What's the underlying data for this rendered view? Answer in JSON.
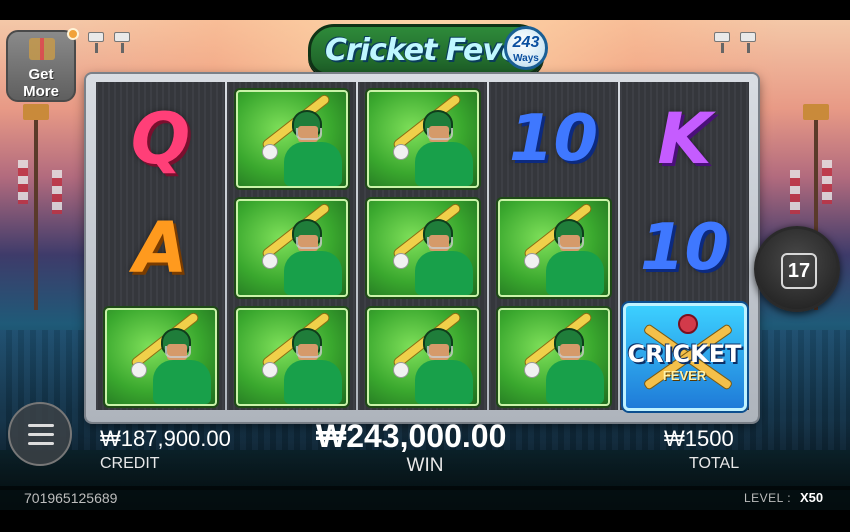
{
  "game": {
    "title_main": "Cricket Fever",
    "ways_number": "243",
    "ways_label": "Ways"
  },
  "get_more": {
    "line1": "Get",
    "line2": "More",
    "icon": "gift-icon"
  },
  "reels": [
    [
      "Q",
      "A",
      "batsman"
    ],
    [
      "batsman",
      "batsman",
      "batsman"
    ],
    [
      "batsman",
      "batsman",
      "batsman"
    ],
    [
      "10",
      "batsman",
      "batsman"
    ],
    [
      "K",
      "10",
      "scatter"
    ]
  ],
  "scatter_symbol": {
    "line1": "CRICKET",
    "line2": "FEVER"
  },
  "spin_counter": {
    "value": "17"
  },
  "balance": {
    "credit_value": "₩187,900.00",
    "credit_label": "CREDIT",
    "win_value": "₩243,000.00",
    "win_label": "WIN",
    "total_value": "₩1500",
    "total_label": "TOTAL"
  },
  "footer": {
    "session_id": "701965125689",
    "level_label": "LEVEL :",
    "level_value": "X50"
  },
  "colors": {
    "logo_green": "#2e8a3a",
    "symbol_q": "#ff3f78",
    "symbol_a": "#ff9a1e",
    "symbol_k": "#c55cff",
    "symbol_10": "#3f78ff",
    "notify_dot": "#f1a23a"
  }
}
